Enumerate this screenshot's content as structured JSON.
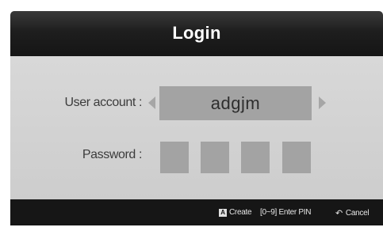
{
  "dialog": {
    "title": "Login"
  },
  "user_account": {
    "label": "User account :",
    "value": "adgjm"
  },
  "password": {
    "label": "Password :",
    "pin_slots": 4
  },
  "footer": {
    "create": {
      "key": "A",
      "label": "Create"
    },
    "enter_pin": {
      "label": "[0~9] Enter PIN"
    },
    "cancel": {
      "icon": "return-icon",
      "label": "Cancel"
    }
  },
  "colors": {
    "header": "#1e1e1e",
    "body": "#cfcfcf",
    "field": "#a3a3a3",
    "footer": "#161616"
  }
}
